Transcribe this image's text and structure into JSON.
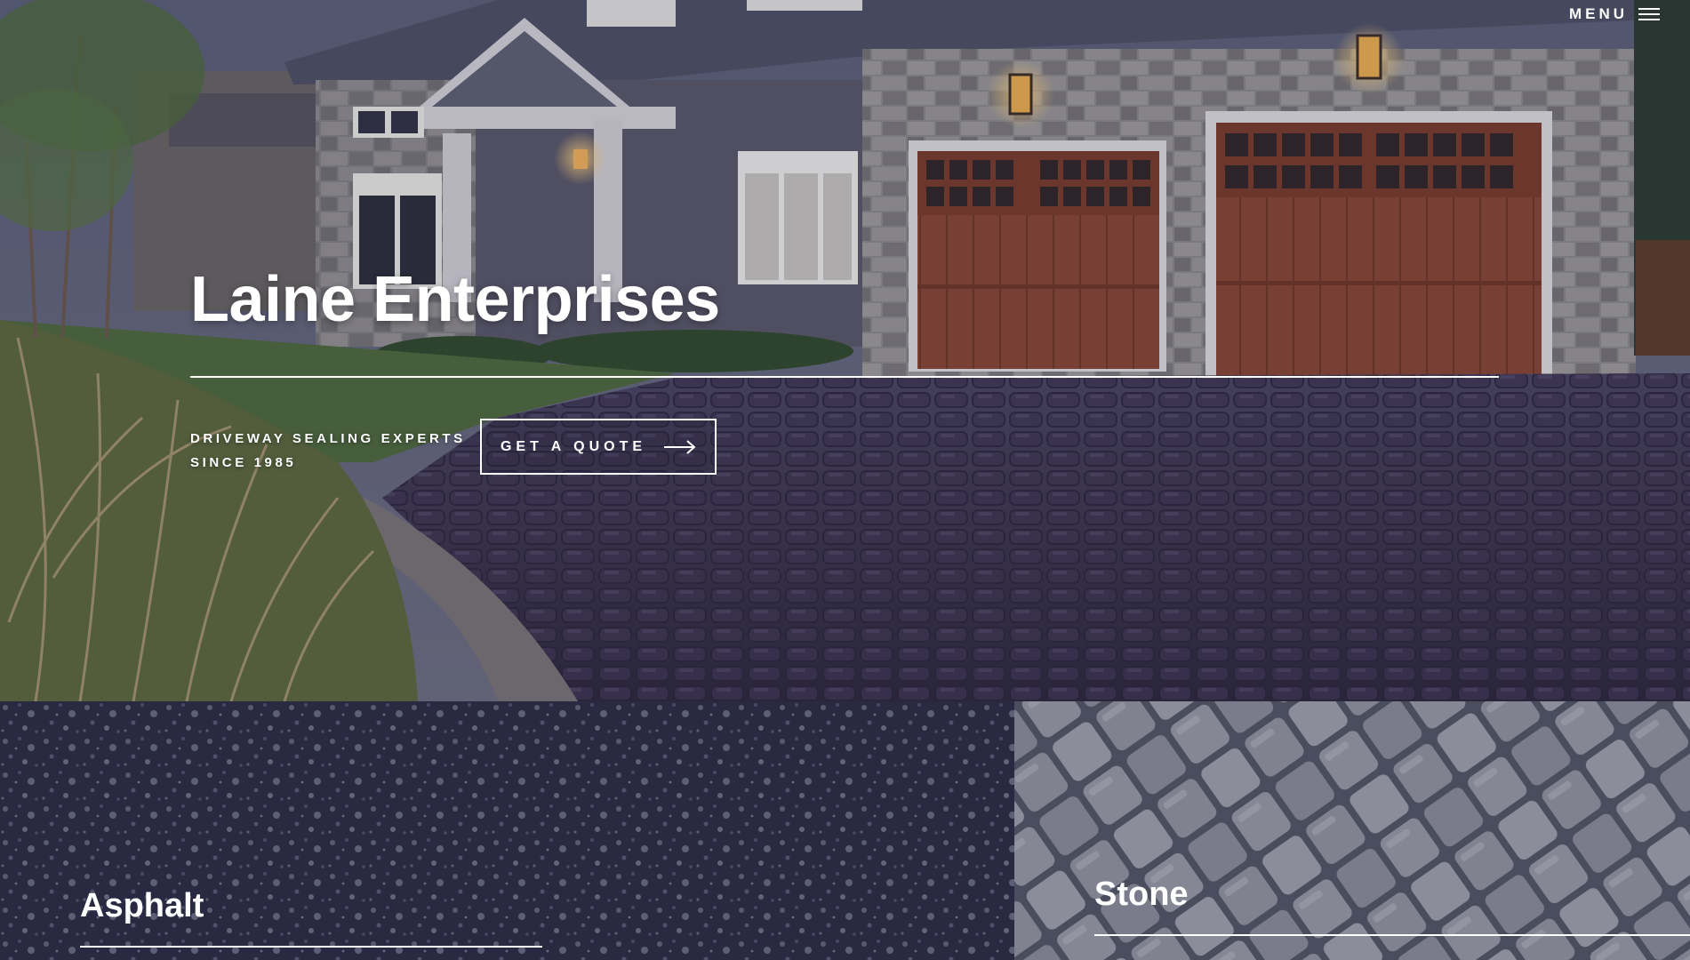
{
  "header": {
    "menu_label": "MENU",
    "menu_icon": "hamburger-icon"
  },
  "hero": {
    "title": "Laine Enterprises",
    "tagline_line1": "DRIVEWAY SEALING EXPERTS",
    "tagline_line2": "SINCE 1985",
    "cta_label": "GET A QUOTE",
    "cta_icon": "arrow-right-icon"
  },
  "cards": {
    "asphalt": {
      "title": "Asphalt"
    },
    "stone": {
      "title": "Stone"
    }
  },
  "colors": {
    "overlay": "#2b2d48",
    "text": "#ffffff",
    "garage_door": "#8a4630",
    "stone_wall": "#9a9893"
  }
}
